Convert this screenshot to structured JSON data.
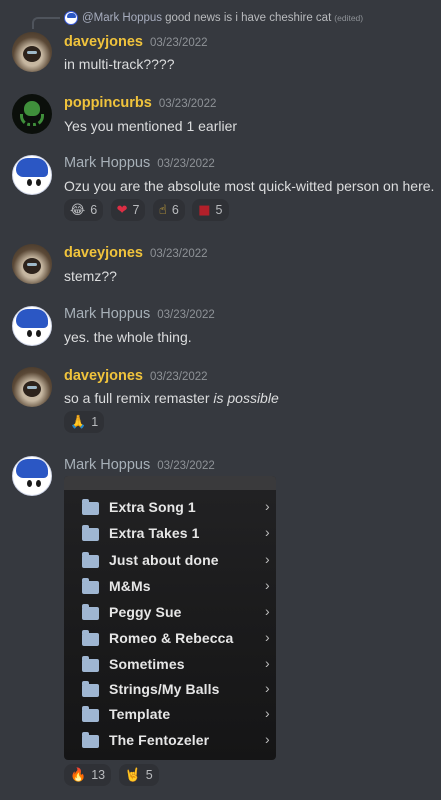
{
  "reply": {
    "name": "@Mark Hoppus",
    "text": "good news is i have cheshire cat",
    "edited": "(edited)"
  },
  "messages": [
    {
      "author": "daveyjones",
      "timestamp": "03/23/2022",
      "text": "in multi-track????"
    },
    {
      "author": "poppincurbs",
      "timestamp": "03/23/2022",
      "text": "Yes you mentioned 1 earlier"
    },
    {
      "author": "Mark Hoppus",
      "timestamp": "03/23/2022",
      "text": "Ozu you are the absolute most quick-witted person on here.",
      "reactions": [
        {
          "emoji": "😂",
          "count": "6"
        },
        {
          "emoji": "❤",
          "count": "7"
        },
        {
          "emoji": "☝",
          "count": "6"
        },
        {
          "emoji": "■",
          "count": "5"
        }
      ]
    },
    {
      "author": "daveyjones",
      "timestamp": "03/23/2022",
      "text": "stemz??"
    },
    {
      "author": "Mark Hoppus",
      "timestamp": "03/23/2022",
      "text": "yes. the whole thing."
    },
    {
      "author": "daveyjones",
      "timestamp": "03/23/2022",
      "text": "so a full remix remaster ",
      "text_italic": "is possible",
      "reactions": [
        {
          "emoji": "🙏",
          "count": "1"
        }
      ]
    },
    {
      "author": "Mark Hoppus",
      "timestamp": "03/23/2022",
      "reactions": [
        {
          "emoji": "🔥",
          "count": "13"
        },
        {
          "emoji": "🤘",
          "count": "5"
        }
      ]
    }
  ],
  "folders": [
    "Extra Song 1",
    "Extra Takes 1",
    "Just about done",
    "M&Ms",
    "Peggy Sue",
    "Romeo & Rebecca",
    "Sometimes",
    "Strings/My Balls",
    "Template",
    "The Fentozeler"
  ],
  "colors": {
    "background": "#36393f",
    "username_gold": "#f0c33c",
    "username_gray": "#a7b0b8",
    "reaction_bg": "#2f3136"
  }
}
